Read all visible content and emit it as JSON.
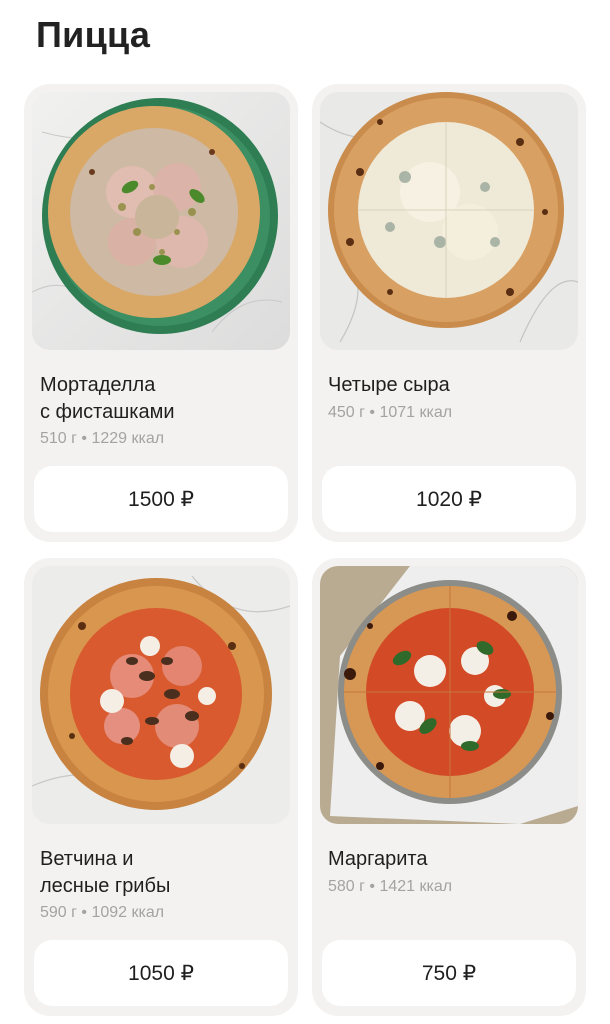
{
  "section": {
    "title": "Пицца"
  },
  "products": [
    {
      "name": "Мортаделла\nс фисташками",
      "meta": "510 г • 1229 ккал",
      "price": "1500 ₽",
      "image": "mortadella-pistachio-pizza"
    },
    {
      "name": "Четыре сыра",
      "meta": "450 г • 1071 ккал",
      "price": "1020 ₽",
      "image": "four-cheese-pizza"
    },
    {
      "name": "Ветчина и\nлесные грибы",
      "meta": "590 г • 1092 ккал",
      "price": "1050 ₽",
      "image": "ham-mushroom-pizza"
    },
    {
      "name": "Маргарита",
      "meta": "580 г • 1421 ккал",
      "price": "750 ₽",
      "image": "margherita-pizza"
    }
  ]
}
